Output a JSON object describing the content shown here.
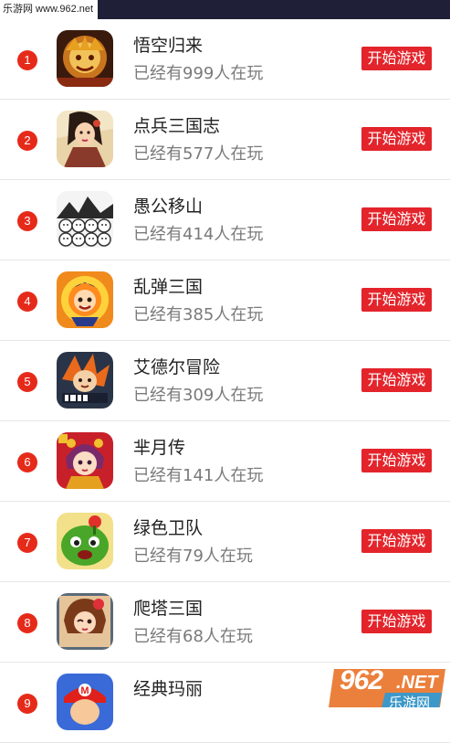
{
  "watermark": {
    "top_text": "乐游网 www.962.net",
    "bottom_number": "962",
    "bottom_net": ".NET",
    "bottom_cn": "乐游网"
  },
  "play_label": "开始游戏",
  "games": [
    {
      "rank": "1",
      "name": "悟空归来",
      "players": "已经有999人在玩",
      "icon": "monkey-king-icon"
    },
    {
      "rank": "2",
      "name": "点兵三国志",
      "players": "已经有577人在玩",
      "icon": "warrior-woman-icon"
    },
    {
      "rank": "3",
      "name": "愚公移山",
      "players": "已经有414人在玩",
      "icon": "mountain-faces-icon"
    },
    {
      "rank": "4",
      "name": "乱弹三国",
      "players": "已经有385人在玩",
      "icon": "fire-hero-icon"
    },
    {
      "rank": "5",
      "name": "艾德尔冒险",
      "players": "已经有309人在玩",
      "icon": "idle-adventure-icon"
    },
    {
      "rank": "6",
      "name": "芈月传",
      "players": "已经有141人在玩",
      "icon": "mi-yue-icon"
    },
    {
      "rank": "7",
      "name": "绿色卫队",
      "players": "已经有79人在玩",
      "icon": "green-monster-icon"
    },
    {
      "rank": "8",
      "name": "爬塔三国",
      "players": "已经有68人在玩",
      "icon": "tower-girl-icon"
    },
    {
      "rank": "9",
      "name": "经典玛丽",
      "players": "",
      "icon": "mario-icon"
    }
  ]
}
